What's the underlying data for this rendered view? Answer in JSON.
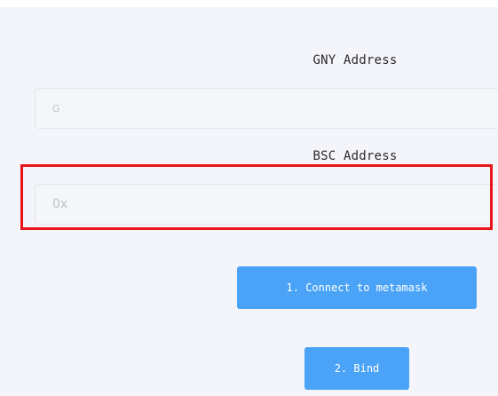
{
  "form": {
    "gny_label": "GNY Address",
    "gny_placeholder": "G",
    "bsc_label": "BSC Address",
    "bsc_placeholder": "0x"
  },
  "buttons": {
    "connect_label": "1. Connect to metamask",
    "bind_label": "2. Bind"
  },
  "colors": {
    "primary": "#4aa3f7",
    "highlight": "#e8151a",
    "background": "#f4f5fa"
  }
}
